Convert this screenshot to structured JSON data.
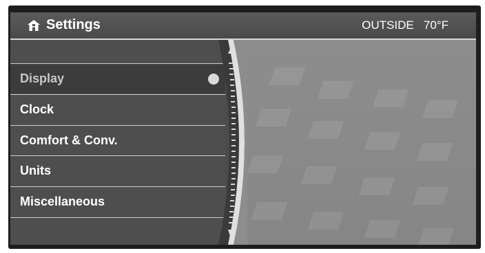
{
  "header": {
    "title": "Settings",
    "icon": "home-icon",
    "outside_label": "OUTSIDE",
    "outside_temp": "70°F"
  },
  "menu": {
    "items": [
      {
        "label": "Display",
        "selected": true
      },
      {
        "label": "Clock",
        "selected": false
      },
      {
        "label": "Comfort & Conv.",
        "selected": false
      },
      {
        "label": "Units",
        "selected": false
      },
      {
        "label": "Miscellaneous",
        "selected": false
      }
    ]
  },
  "colors": {
    "header_bg": "#4a4a4a",
    "menu_bg": "#4e4e4e",
    "selected_bg": "#3c3c3c",
    "divider": "#cfcfcf",
    "map_bg": "#8d8d8d"
  }
}
